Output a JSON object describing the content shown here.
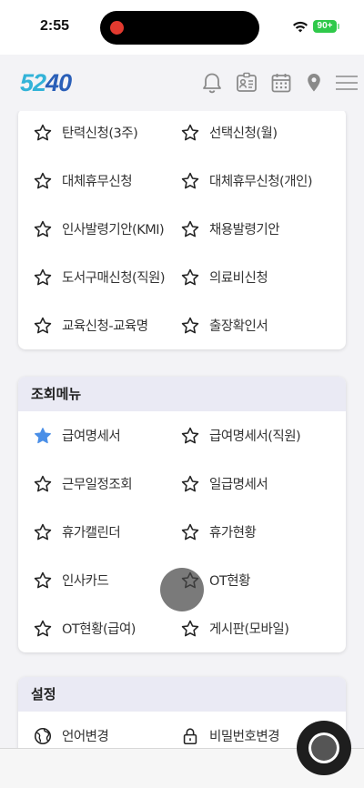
{
  "status_bar": {
    "time": "2:55",
    "battery": "90+"
  },
  "header": {
    "logo_part1": "52",
    "logo_part2": "40",
    "icons": [
      "bell-icon",
      "id-card-icon",
      "calendar-icon",
      "location-pin-icon",
      "menu-icon"
    ]
  },
  "top_card": {
    "items": [
      {
        "label": "탄력신청(3주)",
        "starred": false
      },
      {
        "label": "선택신청(월)",
        "starred": false
      },
      {
        "label": "대체휴무신청",
        "starred": false
      },
      {
        "label": "대체휴무신청(개인)",
        "starred": false
      },
      {
        "label": "인사발령기안(KMI)",
        "starred": false
      },
      {
        "label": "채용발령기안",
        "starred": false
      },
      {
        "label": "도서구매신청(직원)",
        "starred": false
      },
      {
        "label": "의료비신청",
        "starred": false
      },
      {
        "label": "교육신청-교육명",
        "starred": false
      },
      {
        "label": "출장확인서",
        "starred": false
      }
    ]
  },
  "query_card": {
    "title": "조회메뉴",
    "items": [
      {
        "label": "급여명세서",
        "starred": true
      },
      {
        "label": "급여명세서(직원)",
        "starred": false
      },
      {
        "label": "근무일정조회",
        "starred": false
      },
      {
        "label": "일급명세서",
        "starred": false
      },
      {
        "label": "휴가캘린더",
        "starred": false
      },
      {
        "label": "휴가현황",
        "starred": false
      },
      {
        "label": "인사카드",
        "starred": false
      },
      {
        "label": "OT현황",
        "starred": false
      },
      {
        "label": "OT현황(급여)",
        "starred": false
      },
      {
        "label": "게시판(모바일)",
        "starred": false
      }
    ]
  },
  "settings_card": {
    "title": "설정",
    "items": [
      {
        "label": "언어변경",
        "icon": "globe-icon"
      },
      {
        "label": "비밀번호변경",
        "icon": "lock-icon"
      }
    ]
  },
  "colors": {
    "star_filled": "#4a8fe7",
    "header_bg": "#eaeaf4",
    "logo_light": "#33b3d8",
    "logo_dark": "#2a5fb8"
  }
}
